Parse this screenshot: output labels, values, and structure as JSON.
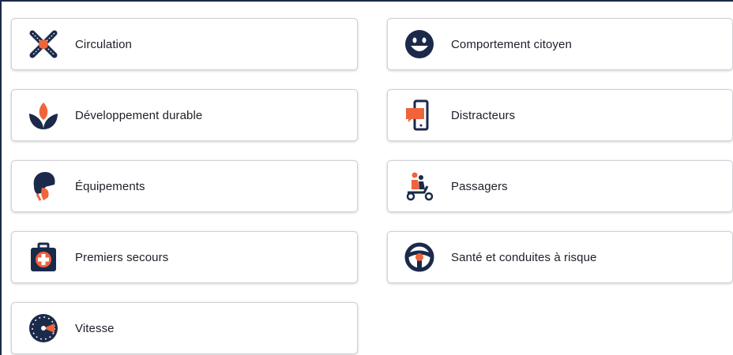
{
  "categories": [
    {
      "label": "Circulation",
      "icon": "crossroads-icon"
    },
    {
      "label": "Comportement citoyen",
      "icon": "smiley-icon"
    },
    {
      "label": "Développement durable",
      "icon": "leaves-icon"
    },
    {
      "label": "Distracteurs",
      "icon": "smartphone-icon"
    },
    {
      "label": "Équipements",
      "icon": "helmet-icon"
    },
    {
      "label": "Passagers",
      "icon": "scooter-passengers-icon"
    },
    {
      "label": "Premiers secours",
      "icon": "first-aid-kit-icon"
    },
    {
      "label": "Santé et conduites à risque",
      "icon": "steering-wheel-icon"
    },
    {
      "label": "Vitesse",
      "icon": "speedometer-icon"
    }
  ],
  "colors": {
    "navy": "#1b2a4a",
    "accent": "#f0643c"
  }
}
